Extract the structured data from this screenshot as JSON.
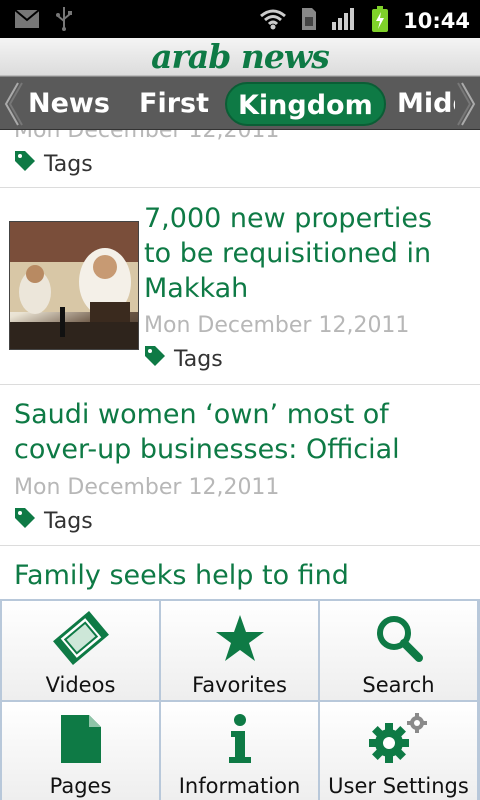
{
  "status_bar": {
    "time": "10:44"
  },
  "header": {
    "logo": "arab news"
  },
  "tabs": [
    {
      "label": "News"
    },
    {
      "label": "First"
    },
    {
      "label": "Kingdom"
    },
    {
      "label": "Middle East"
    }
  ],
  "articles": [
    {
      "headline": "",
      "date": "Mon December 12,2011",
      "tags_label": "Tags"
    },
    {
      "headline": "7,000 new properties to be requisitioned in Makkah",
      "date": "Mon December 12,2011",
      "tags_label": "Tags"
    },
    {
      "headline": "Saudi women ‘own’ most of cover-up businesses: Official",
      "date": "Mon December 12,2011",
      "tags_label": "Tags"
    },
    {
      "headline": "Family seeks help to find",
      "date": "",
      "tags_label": ""
    }
  ],
  "menu": [
    {
      "label": "Videos",
      "icon": "film-icon"
    },
    {
      "label": "Favorites",
      "icon": "star-icon"
    },
    {
      "label": "Search",
      "icon": "search-icon"
    },
    {
      "label": "Pages",
      "icon": "page-icon"
    },
    {
      "label": "Information",
      "icon": "info-icon"
    },
    {
      "label": "User Settings",
      "icon": "gears-icon"
    }
  ],
  "colors": {
    "brand_green": "#0e7a45",
    "menu_border": "#b8c8da",
    "tab_bg": "#5a5a5a"
  }
}
